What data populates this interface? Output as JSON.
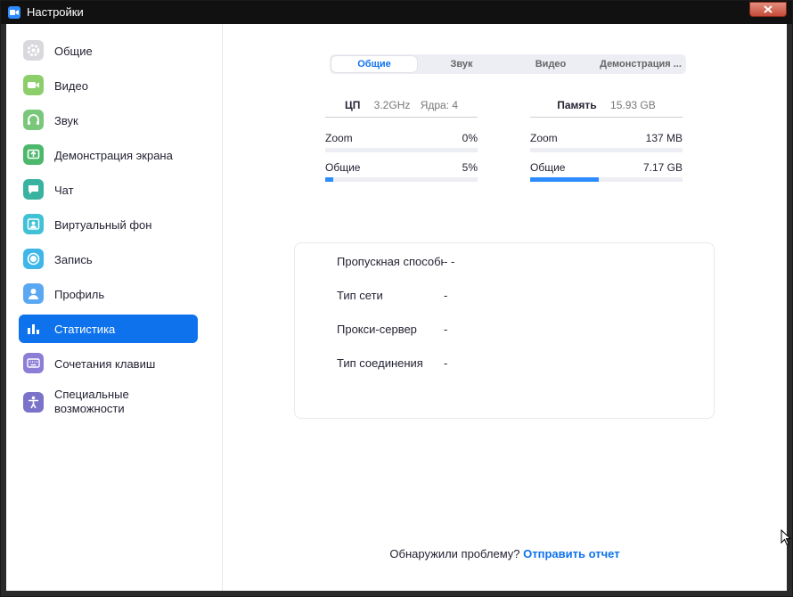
{
  "window": {
    "title": "Настройки"
  },
  "sidebar": {
    "items": [
      {
        "label": "Общие",
        "icon": "gear-icon",
        "color": "#d9d9dd",
        "active": false
      },
      {
        "label": "Видео",
        "icon": "video-camera-icon",
        "color": "#8ccf6a",
        "active": false
      },
      {
        "label": "Звук",
        "icon": "headphones-icon",
        "color": "#7ac77c",
        "active": false
      },
      {
        "label": "Демонстрация экрана",
        "icon": "share-screen-icon",
        "color": "#4cb86b",
        "active": false
      },
      {
        "label": "Чат",
        "icon": "chat-bubble-icon",
        "color": "#39b3a0",
        "active": false
      },
      {
        "label": "Виртуальный фон",
        "icon": "virtual-background-icon",
        "color": "#40c1d6",
        "active": false
      },
      {
        "label": "Запись",
        "icon": "record-icon",
        "color": "#3fb6e8",
        "active": false
      },
      {
        "label": "Профиль",
        "icon": "profile-icon",
        "color": "#5aa8f2",
        "active": false
      },
      {
        "label": "Статистика",
        "icon": "statistics-icon",
        "color": "#0e72ed",
        "active": true
      },
      {
        "label": "Сочетания клавиш",
        "icon": "keyboard-icon",
        "color": "#8c7ed6",
        "active": false
      },
      {
        "label": "Специальные возможности",
        "icon": "accessibility-icon",
        "color": "#7a73c9",
        "active": false
      }
    ]
  },
  "tabs": [
    {
      "label": "Общие",
      "active": true
    },
    {
      "label": "Звук",
      "active": false
    },
    {
      "label": "Видео",
      "active": false
    },
    {
      "label": "Демонстрация ...",
      "active": false
    }
  ],
  "cpu": {
    "title": "ЦП",
    "info": "3.2GHz",
    "cores": "Ядра: 4",
    "rows": [
      {
        "label": "Zoom",
        "value": "0%",
        "fill_percent": 0
      },
      {
        "label": "Общие",
        "value": "5%",
        "fill_percent": 5
      }
    ]
  },
  "memory": {
    "title": "Память",
    "info": "15.93 GB",
    "rows": [
      {
        "label": "Zoom",
        "value": "137 MB",
        "fill_percent": 0
      },
      {
        "label": "Общие",
        "value": "7.17 GB",
        "fill_percent": 45
      }
    ]
  },
  "network": {
    "rows": [
      {
        "label": "Пропускная способность",
        "value": "- -"
      },
      {
        "label": "Тип сети",
        "value": "-"
      },
      {
        "label": "Прокси-сервер",
        "value": "-"
      },
      {
        "label": "Тип соединения",
        "value": "-"
      }
    ]
  },
  "footer": {
    "question": "Обнаружили проблему?",
    "link": "Отправить отчет"
  },
  "colors": {
    "accent": "#0e72ed",
    "bar": "#2d8cff"
  }
}
